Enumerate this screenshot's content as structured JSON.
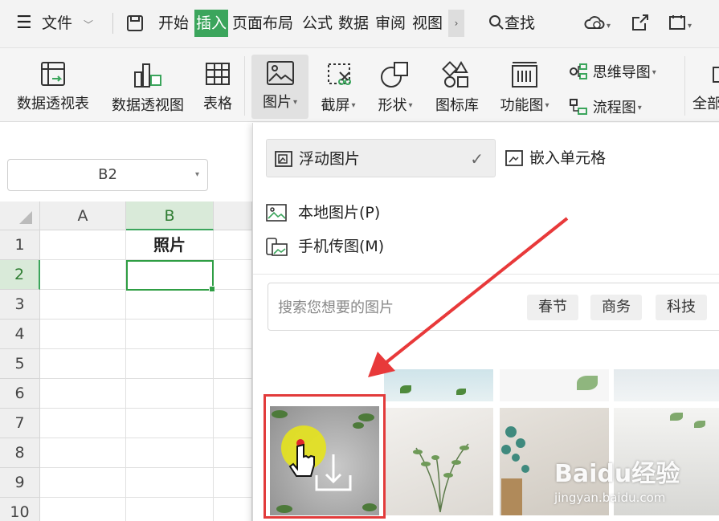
{
  "topbar": {
    "file_label": "文件",
    "tabs": [
      "开始",
      "插入",
      "页面布局",
      "公式",
      "数据",
      "审阅",
      "视图"
    ],
    "active_tab": "插入",
    "search_label": "查找"
  },
  "ribbon": {
    "buttons": [
      {
        "label": "数据透视表"
      },
      {
        "label": "数据透视图"
      },
      {
        "label": "表格"
      },
      {
        "label": "图片"
      },
      {
        "label": "截屏"
      },
      {
        "label": "形状"
      },
      {
        "label": "图标库"
      },
      {
        "label": "功能图"
      }
    ],
    "mindmap_label": "思维导图",
    "flowchart_label": "流程图",
    "overflow_label": "全部"
  },
  "namebox": {
    "value": "B2"
  },
  "grid": {
    "columns": [
      "A",
      "B"
    ],
    "rows": [
      "1",
      "2",
      "3",
      "4",
      "5",
      "6",
      "7",
      "8",
      "9",
      "10"
    ],
    "b1_value": "照片"
  },
  "panel": {
    "mode_float": "浮动图片",
    "mode_embed": "嵌入单元格",
    "local_picture": "本地图片(P)",
    "phone_picture": "手机传图(M)",
    "search_placeholder": "搜索您想要的图片",
    "chips": [
      "春节",
      "商务",
      "科技"
    ]
  },
  "watermark": {
    "brand": "Baidu经验",
    "url": "jingyan.baidu.com"
  },
  "colors": {
    "accent": "#3ba55c",
    "highlight": "#e23b3b"
  }
}
